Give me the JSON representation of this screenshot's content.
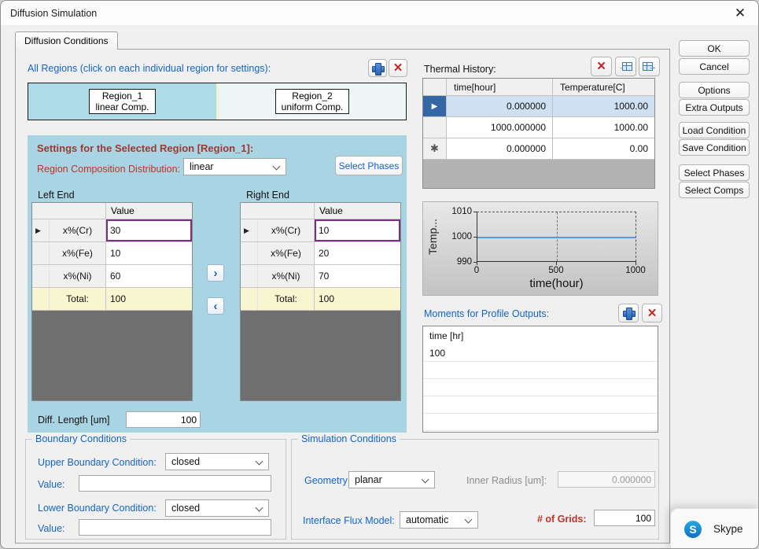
{
  "window": {
    "title": "Diffusion Simulation"
  },
  "icons": {
    "close": "✕",
    "delete_x": "×",
    "chevron_right": "›",
    "chevron_left": "‹",
    "row_arrow": "▶",
    "new_row_marker": "✱",
    "import_arrow": "→",
    "export_arrow": "→",
    "skype_s": "S"
  },
  "tab": {
    "label": "Diffusion Conditions"
  },
  "regions": {
    "label": "All Regions (click on each individual region for settings):",
    "items": [
      {
        "name": "Region_1",
        "comp": "linear Comp."
      },
      {
        "name": "Region_2",
        "comp": "uniform Comp."
      }
    ]
  },
  "settings": {
    "title": "Settings for the Selected Region [Region_1]:",
    "distribution_label": "Region Composition Distribution:",
    "distribution_value": "linear",
    "select_phases": "Select Phases",
    "left_end_label": "Left End",
    "right_end_label": "Right End",
    "value_header": "Value",
    "total_label": "Total:",
    "left_rows": [
      {
        "label": "x%(Cr)",
        "value": "30"
      },
      {
        "label": "x%(Fe)",
        "value": "10"
      },
      {
        "label": "x%(Ni)",
        "value": "60"
      }
    ],
    "left_total": "100",
    "right_rows": [
      {
        "label": "x%(Cr)",
        "value": "10"
      },
      {
        "label": "x%(Fe)",
        "value": "20"
      },
      {
        "label": "x%(Ni)",
        "value": "70"
      }
    ],
    "right_total": "100",
    "diff_length_label": "Diff. Length [um]",
    "diff_length_value": "100"
  },
  "thermal": {
    "label": "Thermal History:",
    "columns": [
      "time[hour]",
      "Temperature[C]"
    ],
    "rows": [
      {
        "time": "0.000000",
        "temp": "1000.00"
      },
      {
        "time": "1000.000000",
        "temp": "1000.00"
      },
      {
        "time": "0.000000",
        "temp": "0.00"
      }
    ]
  },
  "chart_data": {
    "type": "line",
    "series": [
      {
        "name": "Temperature",
        "x": [
          0,
          1000
        ],
        "y": [
          1000,
          1000
        ]
      }
    ],
    "title": "",
    "xlabel": "time(hour)",
    "ylabel": "Temp...",
    "xlim": [
      0,
      1000
    ],
    "ylim": [
      990,
      1010
    ],
    "xticks": [
      0,
      500,
      1000
    ],
    "yticks": [
      990,
      1000,
      1010
    ],
    "line_color": "#5b9bd5",
    "grid": "dashed top/right frame, dashed vertical gridline at x=500"
  },
  "moments": {
    "label": "Moments for Profile Outputs:",
    "header": "time [hr]",
    "rows": [
      "100"
    ]
  },
  "boundary": {
    "title": "Boundary Conditions",
    "upper_label": "Upper Boundary Condition:",
    "upper_value": "closed",
    "upper_value_label": "Value:",
    "upper_value_field": "",
    "lower_label": "Lower Boundary Condition:",
    "lower_value": "closed",
    "lower_value_label": "Value:",
    "lower_value_field": ""
  },
  "simulation": {
    "title": "Simulation Conditions",
    "geometry_label": "Geometry:",
    "geometry_value": "planar",
    "inner_radius_label": "Inner Radius [um]:",
    "inner_radius_value": "0.000000",
    "flux_label": "Interface Flux Model:",
    "flux_value": "automatic",
    "grids_label": "# of Grids:",
    "grids_value": "100"
  },
  "actions": [
    "OK",
    "Cancel",
    "Options",
    "Extra Outputs",
    "Load Condition",
    "Save Condition",
    "Select Phases",
    "Select Comps"
  ],
  "skype": {
    "label": "Skype"
  },
  "colors": {
    "accent_blue": "#1464c8",
    "label_red": "#c03328",
    "heading_maroon": "#9c3a32",
    "panel_blue": "#a9d4e3",
    "selected_cell_border": "#7b2f85",
    "line_blue": "#5b9bd5"
  }
}
